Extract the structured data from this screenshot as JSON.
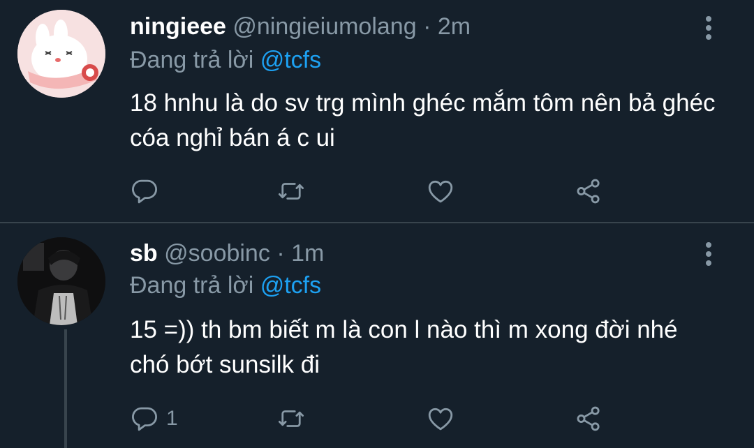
{
  "tweets": [
    {
      "name": "ningieee",
      "handle": "@ningieiumolang",
      "separator": "·",
      "time": "2m",
      "replying_prefix": "Đang trả lời",
      "replying_to": "@tcfs",
      "text": "18 hnhu là do sv trg mình ghéc mắm tôm nên bả ghéc cóa nghỉ bán á c ui",
      "reply_count": ""
    },
    {
      "name": "sb",
      "handle": "@soobinc",
      "separator": "·",
      "time": "1m",
      "replying_prefix": "Đang trả lời",
      "replying_to": "@tcfs",
      "text": "15 =)) th bm biết m là con l nào thì m xong đời nhé chó bớt sunsilk đi",
      "reply_count": "1"
    }
  ],
  "icons": {
    "reply": "reply-icon",
    "retweet": "retweet-icon",
    "like": "heart-icon",
    "share": "share-icon",
    "more": "more-vertical-icon"
  },
  "colors": {
    "background": "#15202b",
    "secondary_text": "#8899a6",
    "accent": "#1da1f2",
    "divider": "#38444d"
  }
}
